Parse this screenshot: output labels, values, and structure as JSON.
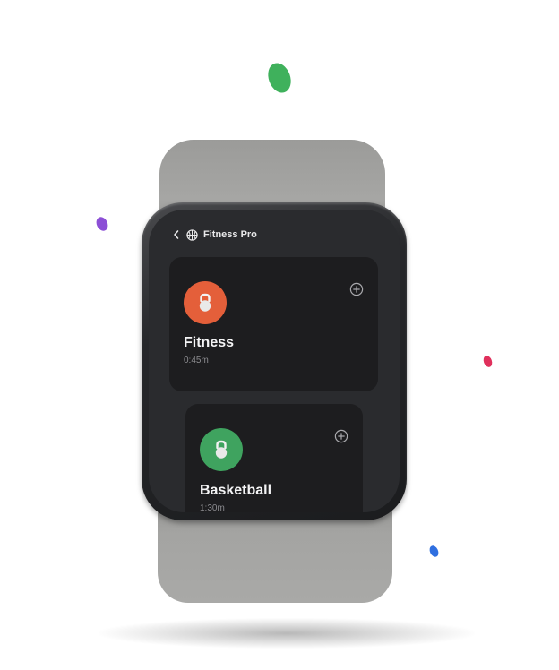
{
  "header": {
    "back_icon": "chevron-left-icon",
    "app_icon": "basketball-icon",
    "title": "Fitness Pro"
  },
  "activities": [
    {
      "title": "Fitness",
      "duration": "0:45m",
      "icon": "kettlebell-icon",
      "color": "#e45f3a",
      "action_icon": "plus-circle-icon"
    },
    {
      "title": "Basketball",
      "duration": "1:30m",
      "icon": "kettlebell-icon",
      "color": "#3fa35f",
      "action_icon": "plus-circle-icon"
    }
  ],
  "decor": {
    "confetti_colors": [
      "#3fb15c",
      "#8c4fd6",
      "#e0305c",
      "#2f6fe0"
    ],
    "band_color": "#a4a4a2",
    "screen_color": "#2a2b2e",
    "card_color": "#1d1d1f"
  }
}
